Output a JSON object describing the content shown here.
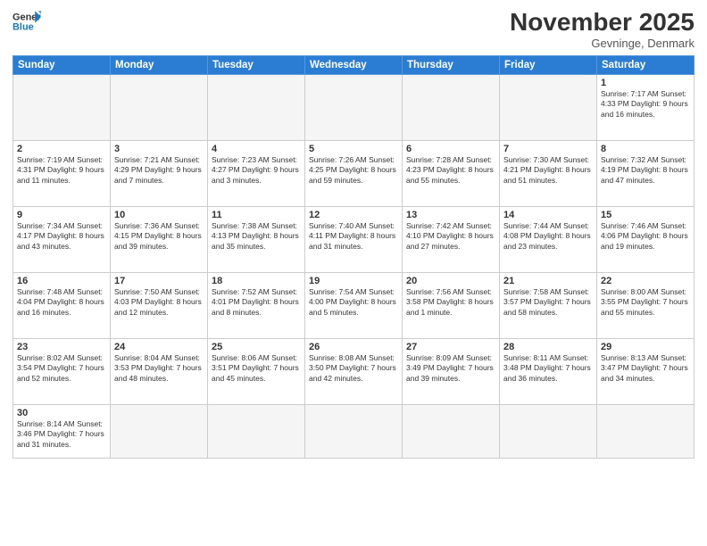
{
  "logo": {
    "line1": "General",
    "line2": "Blue"
  },
  "title": "November 2025",
  "location": "Gevninge, Denmark",
  "weekdays": [
    "Sunday",
    "Monday",
    "Tuesday",
    "Wednesday",
    "Thursday",
    "Friday",
    "Saturday"
  ],
  "weeks": [
    [
      {
        "day": "",
        "info": ""
      },
      {
        "day": "",
        "info": ""
      },
      {
        "day": "",
        "info": ""
      },
      {
        "day": "",
        "info": ""
      },
      {
        "day": "",
        "info": ""
      },
      {
        "day": "",
        "info": ""
      },
      {
        "day": "1",
        "info": "Sunrise: 7:17 AM\nSunset: 4:33 PM\nDaylight: 9 hours\nand 16 minutes."
      }
    ],
    [
      {
        "day": "2",
        "info": "Sunrise: 7:19 AM\nSunset: 4:31 PM\nDaylight: 9 hours\nand 11 minutes."
      },
      {
        "day": "3",
        "info": "Sunrise: 7:21 AM\nSunset: 4:29 PM\nDaylight: 9 hours\nand 7 minutes."
      },
      {
        "day": "4",
        "info": "Sunrise: 7:23 AM\nSunset: 4:27 PM\nDaylight: 9 hours\nand 3 minutes."
      },
      {
        "day": "5",
        "info": "Sunrise: 7:26 AM\nSunset: 4:25 PM\nDaylight: 8 hours\nand 59 minutes."
      },
      {
        "day": "6",
        "info": "Sunrise: 7:28 AM\nSunset: 4:23 PM\nDaylight: 8 hours\nand 55 minutes."
      },
      {
        "day": "7",
        "info": "Sunrise: 7:30 AM\nSunset: 4:21 PM\nDaylight: 8 hours\nand 51 minutes."
      },
      {
        "day": "8",
        "info": "Sunrise: 7:32 AM\nSunset: 4:19 PM\nDaylight: 8 hours\nand 47 minutes."
      }
    ],
    [
      {
        "day": "9",
        "info": "Sunrise: 7:34 AM\nSunset: 4:17 PM\nDaylight: 8 hours\nand 43 minutes."
      },
      {
        "day": "10",
        "info": "Sunrise: 7:36 AM\nSunset: 4:15 PM\nDaylight: 8 hours\nand 39 minutes."
      },
      {
        "day": "11",
        "info": "Sunrise: 7:38 AM\nSunset: 4:13 PM\nDaylight: 8 hours\nand 35 minutes."
      },
      {
        "day": "12",
        "info": "Sunrise: 7:40 AM\nSunset: 4:11 PM\nDaylight: 8 hours\nand 31 minutes."
      },
      {
        "day": "13",
        "info": "Sunrise: 7:42 AM\nSunset: 4:10 PM\nDaylight: 8 hours\nand 27 minutes."
      },
      {
        "day": "14",
        "info": "Sunrise: 7:44 AM\nSunset: 4:08 PM\nDaylight: 8 hours\nand 23 minutes."
      },
      {
        "day": "15",
        "info": "Sunrise: 7:46 AM\nSunset: 4:06 PM\nDaylight: 8 hours\nand 19 minutes."
      }
    ],
    [
      {
        "day": "16",
        "info": "Sunrise: 7:48 AM\nSunset: 4:04 PM\nDaylight: 8 hours\nand 16 minutes."
      },
      {
        "day": "17",
        "info": "Sunrise: 7:50 AM\nSunset: 4:03 PM\nDaylight: 8 hours\nand 12 minutes."
      },
      {
        "day": "18",
        "info": "Sunrise: 7:52 AM\nSunset: 4:01 PM\nDaylight: 8 hours\nand 8 minutes."
      },
      {
        "day": "19",
        "info": "Sunrise: 7:54 AM\nSunset: 4:00 PM\nDaylight: 8 hours\nand 5 minutes."
      },
      {
        "day": "20",
        "info": "Sunrise: 7:56 AM\nSunset: 3:58 PM\nDaylight: 8 hours\nand 1 minute."
      },
      {
        "day": "21",
        "info": "Sunrise: 7:58 AM\nSunset: 3:57 PM\nDaylight: 7 hours\nand 58 minutes."
      },
      {
        "day": "22",
        "info": "Sunrise: 8:00 AM\nSunset: 3:55 PM\nDaylight: 7 hours\nand 55 minutes."
      }
    ],
    [
      {
        "day": "23",
        "info": "Sunrise: 8:02 AM\nSunset: 3:54 PM\nDaylight: 7 hours\nand 52 minutes."
      },
      {
        "day": "24",
        "info": "Sunrise: 8:04 AM\nSunset: 3:53 PM\nDaylight: 7 hours\nand 48 minutes."
      },
      {
        "day": "25",
        "info": "Sunrise: 8:06 AM\nSunset: 3:51 PM\nDaylight: 7 hours\nand 45 minutes."
      },
      {
        "day": "26",
        "info": "Sunrise: 8:08 AM\nSunset: 3:50 PM\nDaylight: 7 hours\nand 42 minutes."
      },
      {
        "day": "27",
        "info": "Sunrise: 8:09 AM\nSunset: 3:49 PM\nDaylight: 7 hours\nand 39 minutes."
      },
      {
        "day": "28",
        "info": "Sunrise: 8:11 AM\nSunset: 3:48 PM\nDaylight: 7 hours\nand 36 minutes."
      },
      {
        "day": "29",
        "info": "Sunrise: 8:13 AM\nSunset: 3:47 PM\nDaylight: 7 hours\nand 34 minutes."
      }
    ],
    [
      {
        "day": "30",
        "info": "Sunrise: 8:14 AM\nSunset: 3:46 PM\nDaylight: 7 hours\nand 31 minutes."
      },
      {
        "day": "",
        "info": ""
      },
      {
        "day": "",
        "info": ""
      },
      {
        "day": "",
        "info": ""
      },
      {
        "day": "",
        "info": ""
      },
      {
        "day": "",
        "info": ""
      },
      {
        "day": "",
        "info": ""
      }
    ]
  ]
}
